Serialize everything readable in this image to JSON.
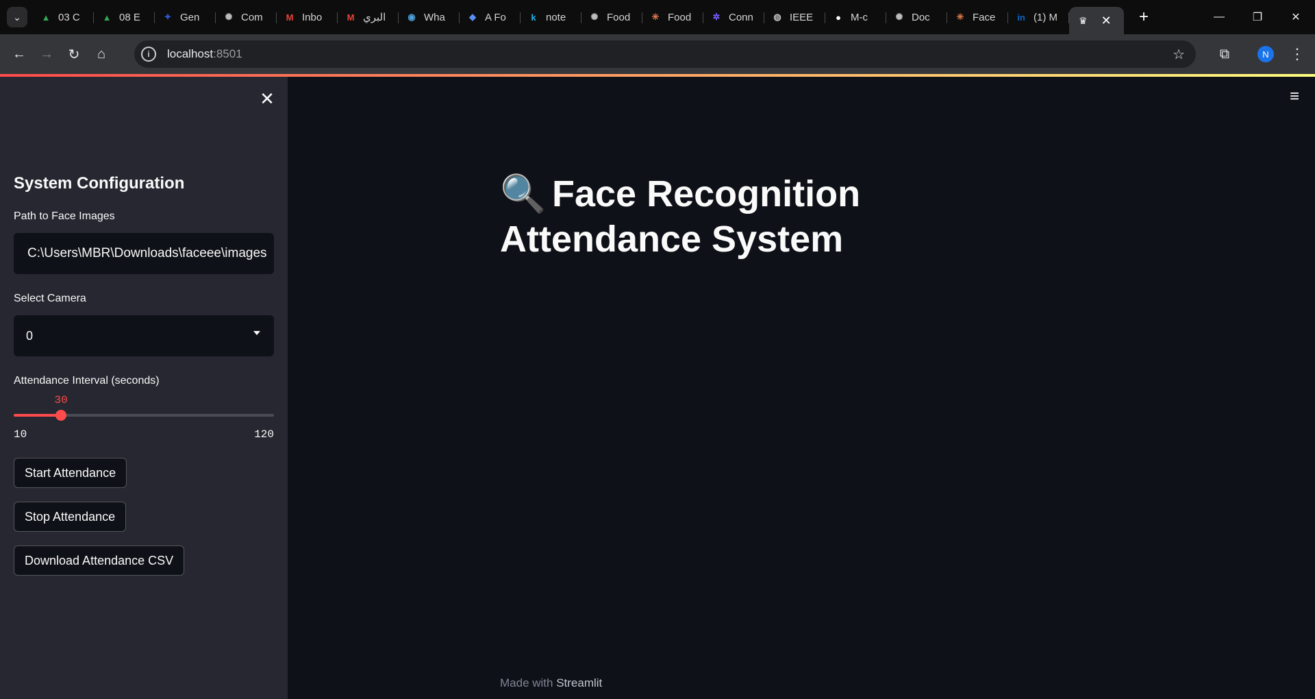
{
  "browser": {
    "tabs": [
      {
        "icon": "google-drive-icon",
        "title": "03 C",
        "color": "#34a853"
      },
      {
        "icon": "google-drive-icon",
        "title": "08 E",
        "color": "#34a853"
      },
      {
        "icon": "genai-icon",
        "title": "Gen",
        "color": "#2d5bd6"
      },
      {
        "icon": "openai-icon",
        "title": "Com",
        "color": "#bdbdbd"
      },
      {
        "icon": "gmail-icon",
        "title": "Inbo",
        "color": "#ea4335"
      },
      {
        "icon": "gmail-icon",
        "title": "البري",
        "color": "#ea4335"
      },
      {
        "icon": "whatsapp-icon",
        "title": "Wha",
        "color": "#4fa0d8"
      },
      {
        "icon": "graduation-cap-icon",
        "title": "A Fo",
        "color": "#5b8def"
      },
      {
        "icon": "k-icon",
        "title": "note",
        "color": "#20b2e8"
      },
      {
        "icon": "openai-icon",
        "title": "Food",
        "color": "#bdbdbd"
      },
      {
        "icon": "claude-icon",
        "title": "Food",
        "color": "#e07a4e"
      },
      {
        "icon": "gear-cluster-icon",
        "title": "Conn",
        "color": "#7b61ff"
      },
      {
        "icon": "globe-icon",
        "title": "IEEE",
        "color": "#bdbdbd"
      },
      {
        "icon": "github-icon",
        "title": "M-c",
        "color": "#ffffff"
      },
      {
        "icon": "openai-icon",
        "title": "Doc",
        "color": "#bdbdbd"
      },
      {
        "icon": "claude-icon",
        "title": "Face",
        "color": "#e07a4e"
      },
      {
        "icon": "linkedin-icon",
        "title": "(1) M",
        "color": "#0a66c2"
      }
    ],
    "active_tab_icon": "streamlit-crown-icon",
    "url_host": "localhost",
    "url_port": ":8501",
    "profile_initial": "N"
  },
  "sidebar": {
    "heading": "System Configuration",
    "path_label": "Path to Face Images",
    "path_value": "C:\\Users\\MBR\\Downloads\\faceee\\images",
    "camera_label": "Select Camera",
    "camera_value": "0",
    "interval_label": "Attendance Interval (seconds)",
    "interval": {
      "min": 10,
      "max": 120,
      "value": 30,
      "min_label": "10",
      "max_label": "120",
      "value_label": "30"
    },
    "buttons": {
      "start": "Start Attendance",
      "stop": "Stop Attendance",
      "download": "Download Attendance CSV"
    }
  },
  "main": {
    "title_emoji": "🔍",
    "title": "Face Recognition Attendance System",
    "footer_prefix": "Made with ",
    "footer_brand": "Streamlit"
  },
  "colors": {
    "accent": "#ff4b4b",
    "background": "#0e1117",
    "sidebar": "#262730"
  }
}
